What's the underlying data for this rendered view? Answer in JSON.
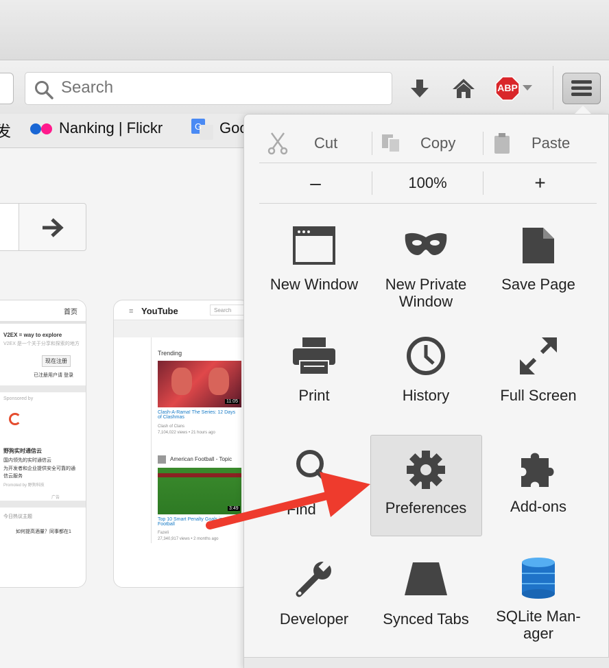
{
  "search": {
    "placeholder": "Search"
  },
  "toolbar": {
    "download_icon": "download-arrow-icon",
    "home_icon": "home-icon",
    "abp_label": "ABP"
  },
  "bookmarks": [
    {
      "label": "发"
    },
    {
      "label": "Nanking | Flickr"
    },
    {
      "label": "Goo"
    }
  ],
  "menu": {
    "edit": {
      "cut": "Cut",
      "copy": "Copy",
      "paste": "Paste"
    },
    "zoom": {
      "minus": "–",
      "level": "100%",
      "plus": "+"
    },
    "items": [
      {
        "label": "New Window",
        "icon": "window-icon"
      },
      {
        "label": "New Private Window",
        "line1": "New Private",
        "line2": "Window",
        "icon": "mask-icon"
      },
      {
        "label": "Save Page",
        "icon": "page-icon"
      },
      {
        "label": "Print",
        "icon": "printer-icon"
      },
      {
        "label": "History",
        "icon": "clock-icon"
      },
      {
        "label": "Full Screen",
        "icon": "fullscreen-icon"
      },
      {
        "label": "Find",
        "icon": "magnifier-icon"
      },
      {
        "label": "Preferences",
        "icon": "gear-icon"
      },
      {
        "label": "Add-ons",
        "icon": "puzzle-icon"
      },
      {
        "label": "Developer",
        "icon": "wrench-icon"
      },
      {
        "label": "Synced Tabs",
        "icon": "synced-tabs-icon"
      },
      {
        "label": "SQLite Manager",
        "line1": "SQLite Man-",
        "line2": "ager",
        "icon": "database-icon"
      }
    ]
  },
  "thumb_v2ex": {
    "nav": "首页",
    "title": "V2EX = way to explore",
    "subtitle": "V2EX 是一个关于分享和探索的地方",
    "signup": "现在注册",
    "login_note": "已注册用户请  登录",
    "sponsored": "Sponsored by",
    "ad_title": "野狗实时通信云",
    "ad_line1": "国内领先的实时通信云",
    "ad_line2": "为开发者和企业提供安全可靠的通",
    "ad_line3": "信云服务",
    "ad_promo": "Promoted by  野狗科技",
    "ad_tag": "广告",
    "hot": "今日热议主题",
    "hot_item": "如何提高酒量？同事都在1"
  },
  "thumb_youtube": {
    "logo": "YouTube",
    "search": "Search",
    "trending": "Trending",
    "v1_title": "Clash-A-Rama! The Series: 12 Days of Clashmas",
    "v1_channel": "Clash of Clans",
    "v1_meta": "7,104,022 views • 21 hours ago",
    "v1_dur": "11:05",
    "topic": "American Football - Topic",
    "v2_title": "Top 10 Smart Penalty Goals in Football",
    "v2_channel": "Fazeli",
    "v2_meta": "27,340,917 views • 2 months ago",
    "v2_dur": "3:49"
  },
  "colors": {
    "accent_arrow": "#ee3b2d",
    "abp_red": "#d9262a",
    "icon_gray": "#4a4a4a"
  }
}
